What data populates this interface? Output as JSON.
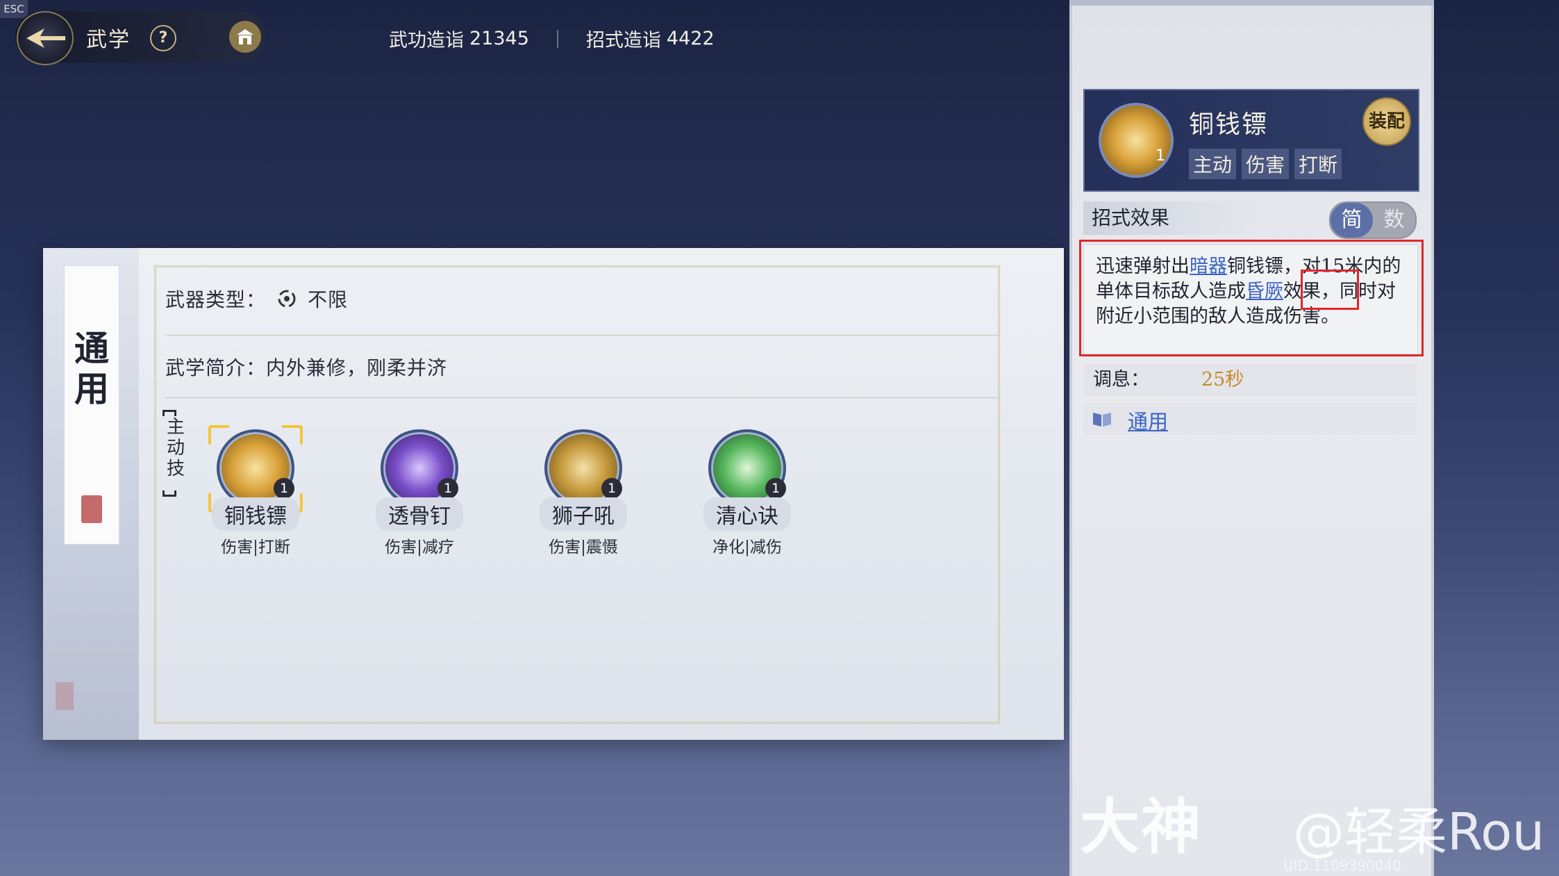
{
  "esc": "ESC",
  "header": {
    "title": "武学",
    "help_icon": "?",
    "stats": [
      {
        "label": "武功造诣",
        "value": "21345"
      },
      {
        "label": "招式造诣",
        "value": "4422"
      }
    ]
  },
  "category_tab": {
    "label": "通用"
  },
  "info": {
    "weapon_label": "武器类型：",
    "weapon_value": "不限",
    "intro_label": "武学简介：",
    "intro_value": "内外兼修，刚柔并济"
  },
  "skill_group_label": "主动技",
  "skills": [
    {
      "name": "铜钱镖",
      "tags": "伤害|打断",
      "level": "1",
      "color": "#d9a23a"
    },
    {
      "name": "透骨钉",
      "tags": "伤害|减疗",
      "level": "1",
      "color": "#7a4ec9"
    },
    {
      "name": "狮子吼",
      "tags": "伤害|震慑",
      "level": "1",
      "color": "#c59a3c"
    },
    {
      "name": "清心诀",
      "tags": "净化|减伤",
      "level": "1",
      "color": "#57b85e"
    }
  ],
  "detail": {
    "name": "铜钱镖",
    "level": "1",
    "tags": [
      "主动",
      "伤害",
      "打断"
    ],
    "equip_label": "装配",
    "effect_header": "招式效果",
    "toggle": [
      "简",
      "数"
    ],
    "effect_parts": [
      {
        "text": "迅速弹射出",
        "kw": false
      },
      {
        "text": "暗器",
        "kw": true
      },
      {
        "text": "铜钱镖，对15米内的单体目标敌人造成",
        "kw": false
      },
      {
        "text": "昏厥",
        "kw": true
      },
      {
        "text": "效果，同时对附近小范围的敌人造成伤害。",
        "kw": false
      }
    ],
    "cooldown_label": "调息：",
    "cooldown_value": "25秒",
    "category_link": "通用"
  },
  "watermark": {
    "logo": "大神",
    "handle": "@轻柔Rou",
    "uid": "UID:1109390040"
  },
  "colors": {
    "accent": "#3b64c2",
    "highlight": "#e1262b",
    "cooldown": "#c88a2a"
  }
}
